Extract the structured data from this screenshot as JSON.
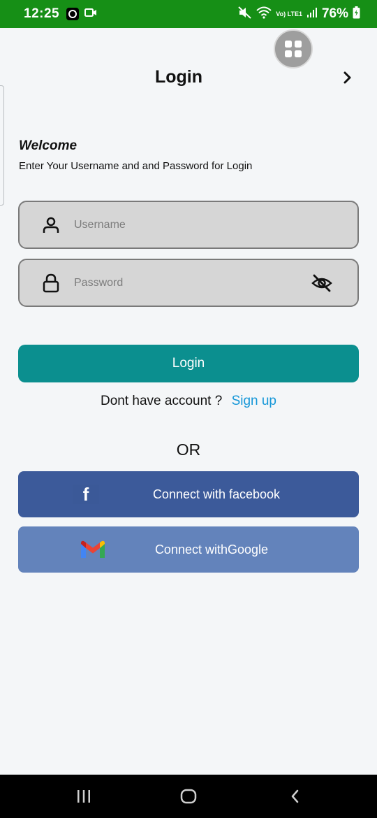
{
  "status_bar": {
    "time": "12:25",
    "network": "Vo) LTE1",
    "battery": "76%"
  },
  "header": {
    "title": "Login"
  },
  "intro": {
    "welcome": "Welcome",
    "subtitle": "Enter Your Username and  and Password for Login"
  },
  "form": {
    "username": {
      "placeholder": "Username",
      "value": ""
    },
    "password": {
      "placeholder": "Password",
      "value": ""
    },
    "login_label": "Login"
  },
  "signup": {
    "prompt": "Dont have account ?",
    "link": "Sign up"
  },
  "divider": "OR",
  "social": {
    "facebook_label": "Connect with facebook",
    "google_label": "Connect withGoogle"
  },
  "colors": {
    "status_bar": "#168f16",
    "login_button": "#0b8f8f",
    "facebook_button": "#3c5a9a",
    "google_button": "#6383bb",
    "link": "#1597d8"
  }
}
